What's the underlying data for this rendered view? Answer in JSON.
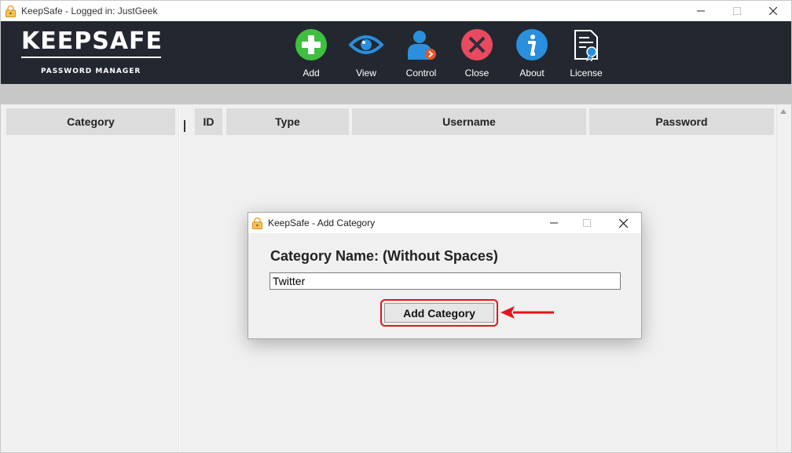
{
  "window": {
    "title": "KeepSafe - Logged in: JustGeek",
    "controls": [
      "minimize",
      "maximize",
      "close"
    ]
  },
  "logo": {
    "main": "KEEPSAFE",
    "sub": "PASSWORD MANAGER"
  },
  "toolbar": [
    {
      "label": "Add",
      "icon": "add-icon",
      "color": "#3fbf3f"
    },
    {
      "label": "View",
      "icon": "eye-icon",
      "color": "#2a8fdc"
    },
    {
      "label": "Control",
      "icon": "user-control-icon",
      "color": "#2a8fdc"
    },
    {
      "label": "Close",
      "icon": "close-circle-icon",
      "color": "#e84a5f"
    },
    {
      "label": "About",
      "icon": "info-icon",
      "color": "#2a8fdc"
    },
    {
      "label": "License",
      "icon": "certificate-icon",
      "color": "#ffffff"
    }
  ],
  "sidebar": {
    "header": "Category"
  },
  "table": {
    "columns": [
      "ID",
      "Type",
      "Username",
      "Password"
    ]
  },
  "dialog": {
    "title": "KeepSafe - Add Category",
    "label": "Category Name: (Without Spaces)",
    "input_value": "Twitter",
    "button_label": "Add Category"
  },
  "colors": {
    "header_bg": "#232830",
    "highlight": "#e3141c",
    "app_icon": "#f0a830"
  }
}
